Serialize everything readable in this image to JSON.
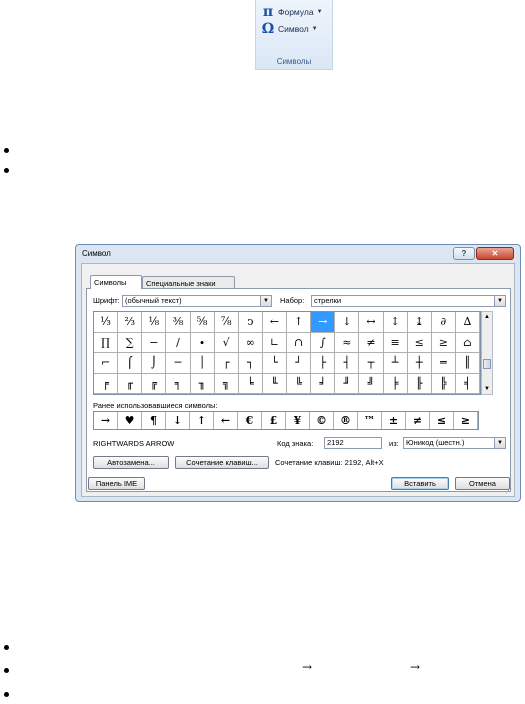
{
  "ribbon": {
    "formula_icon": "pi-icon",
    "formula_label": "Формула",
    "symbol_icon": "omega-icon",
    "symbol_label": "Символ",
    "group_label": "Символы"
  },
  "doc_arrows": [
    "→",
    "→"
  ],
  "dialog": {
    "title": "Символ",
    "help_label": "?",
    "close_label": "✕",
    "tabs": [
      "Символы",
      "Специальные знаки"
    ],
    "font_label": "Шрифт:",
    "font_value": "(обычный текст)",
    "subset_label": "Набор:",
    "subset_value": "стрелки",
    "grid": [
      [
        "⅓",
        "⅔",
        "⅛",
        "⅜",
        "⅝",
        "⅞",
        "ↄ",
        "←",
        "↑",
        "→",
        "↓",
        "↔",
        "↕",
        "↨",
        "∂",
        "∆"
      ],
      [
        "∏",
        "∑",
        "−",
        "∕",
        "∙",
        "√",
        "∞",
        "∟",
        "∩",
        "∫",
        "≈",
        "≠",
        "≡",
        "≤",
        "≥",
        "⌂"
      ],
      [
        "⌐",
        "⌠",
        "⌡",
        "─",
        "│",
        "┌",
        "┐",
        "└",
        "┘",
        "├",
        "┤",
        "┬",
        "┴",
        "┼",
        "═",
        "║"
      ],
      [
        "╒",
        "╓",
        "╔",
        "╕",
        "╖",
        "╗",
        "╘",
        "╙",
        "╚",
        "╛",
        "╜",
        "╝",
        "╞",
        "╟",
        "╠",
        "╡"
      ]
    ],
    "selected_cell": "→",
    "recent_label": "Ранее использовавшиеся символы:",
    "recent": [
      "→",
      "♥",
      "¶",
      "↓",
      "↑",
      "←",
      "€",
      "£",
      "¥",
      "©",
      "®",
      "™",
      "±",
      "≠",
      "≤",
      "≥"
    ],
    "char_name": "RIGHTWARDS ARROW",
    "code_label": "Код знака:",
    "code_value": "2192",
    "from_label": "из:",
    "from_value": "Юникод (шестн.)",
    "autocorrect_label": "Автозамена...",
    "shortcut_key_label": "Сочетание клавиш...",
    "shortcut_text": "Сочетание клавиш: 2192, Alt+X",
    "ime_label": "Панель IME",
    "insert_label": "Вставить",
    "cancel_label": "Отмена"
  }
}
